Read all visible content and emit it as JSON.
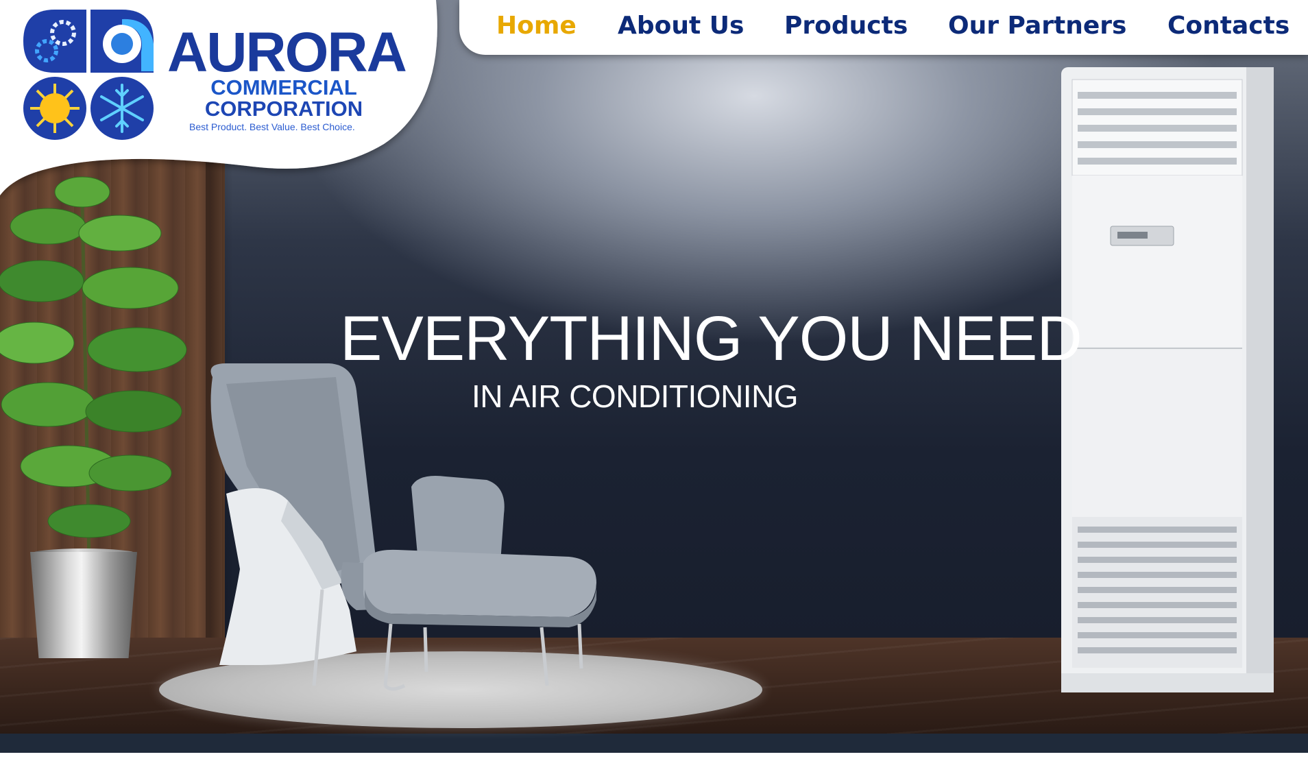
{
  "brand": {
    "name": "AURORA",
    "line1": "COMMERCIAL",
    "line2": "CORPORATION",
    "tagline": "Best Product. Best Value. Best Choice."
  },
  "logo_icons": [
    "gears-icon",
    "swirl-icon",
    "sun-icon",
    "snowflake-icon"
  ],
  "nav": {
    "items": [
      {
        "label": "Home",
        "active": true
      },
      {
        "label": "About Us",
        "active": false
      },
      {
        "label": "Products",
        "active": false
      },
      {
        "label": "Our Partners",
        "active": false
      },
      {
        "label": "Contacts",
        "active": false
      }
    ]
  },
  "hero": {
    "title": "EVERYTHING YOU NEED",
    "subtitle": "IN AIR CONDITIONING"
  },
  "colors": {
    "nav_text": "#0c2a78",
    "nav_active": "#e8a800",
    "brand_blue": "#1a3a9c"
  }
}
